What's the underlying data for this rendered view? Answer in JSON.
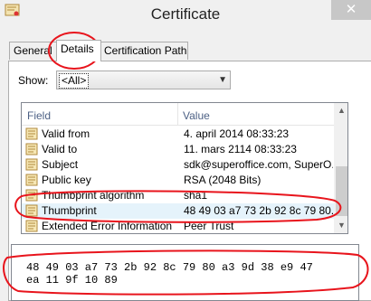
{
  "window": {
    "title": "Certificate",
    "close_glyph": "✕"
  },
  "tabs": [
    {
      "label": "General",
      "active": false
    },
    {
      "label": "Details",
      "active": true
    },
    {
      "label": "Certification Path",
      "active": false
    }
  ],
  "show": {
    "label": "Show:",
    "selected": "<All>"
  },
  "list": {
    "columns": [
      "Field",
      "Value"
    ],
    "rows": [
      {
        "field": "Valid from",
        "value": "4. april 2014 08:33:23"
      },
      {
        "field": "Valid to",
        "value": "11. mars 2114 08:33:23"
      },
      {
        "field": "Subject",
        "value": "sdk@superoffice.com, SuperO..."
      },
      {
        "field": "Public key",
        "value": "RSA (2048 Bits)"
      },
      {
        "field": "Thumbprint algorithm",
        "value": "sha1"
      },
      {
        "field": "Thumbprint",
        "value": "48 49 03 a7 73 2b 92 8c 79 80..."
      },
      {
        "field": "Extended Error Information",
        "value": "Peer Trust"
      }
    ]
  },
  "details_value": {
    "line1": "48 49 03 a7 73 2b 92 8c 79 80 a3 9d 38 e9 47",
    "line2": "ea 11 9f 10 89"
  },
  "colors": {
    "annotation": "#e8141c",
    "selection": "#e5f3fb",
    "header_text": "#4d6185"
  }
}
